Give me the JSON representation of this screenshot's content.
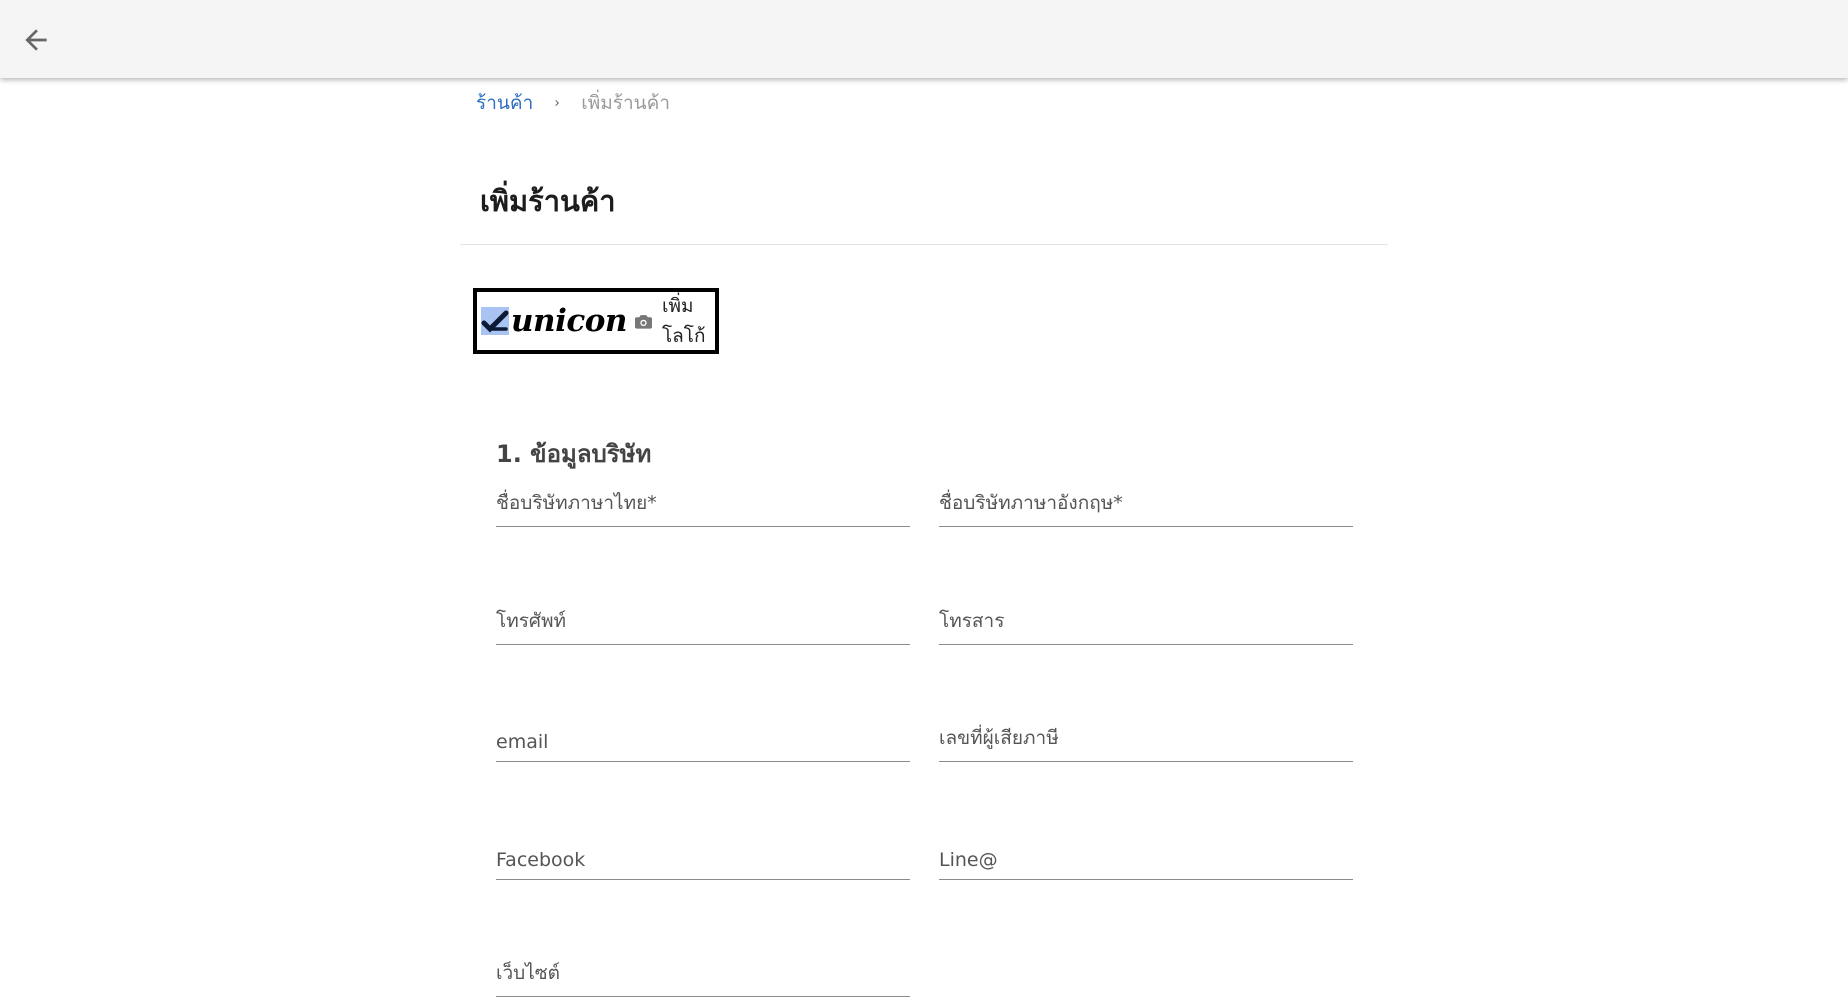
{
  "header": {
    "back_icon": "arrow-left-icon"
  },
  "breadcrumb": {
    "parent": "ร้านค้า",
    "separator_icon": "chevron-right-icon",
    "current": "เพิ่มร้านค้า"
  },
  "page": {
    "title": "เพิ่มร้านค้า"
  },
  "logo": {
    "brand_text": "unicon",
    "camera_icon": "camera-icon",
    "add_label": "เพิ่มโลโก้"
  },
  "section": {
    "title": "1. ข้อมูลบริษัท"
  },
  "fields": {
    "company_name_th": {
      "label": "ชื่อบริษัทภาษาไทย*",
      "value": ""
    },
    "company_name_en": {
      "label": "ชื่อบริษัทภาษาอังกฤษ*",
      "value": ""
    },
    "phone": {
      "label": "โทรศัพท์",
      "value": ""
    },
    "fax": {
      "label": "โทรสาร",
      "value": ""
    },
    "email": {
      "label": "email",
      "value": ""
    },
    "tax_id": {
      "label": "เลขที่ผู้เสียภาษี",
      "value": ""
    },
    "facebook": {
      "label": "Facebook",
      "value": ""
    },
    "line": {
      "label": "Line@",
      "value": ""
    },
    "website": {
      "label": "เว็บไซต์",
      "value": ""
    }
  },
  "colors": {
    "link": "#2f6fc1",
    "topbar": "#f5f5f5",
    "logo_highlight": "#a9c4f3"
  }
}
